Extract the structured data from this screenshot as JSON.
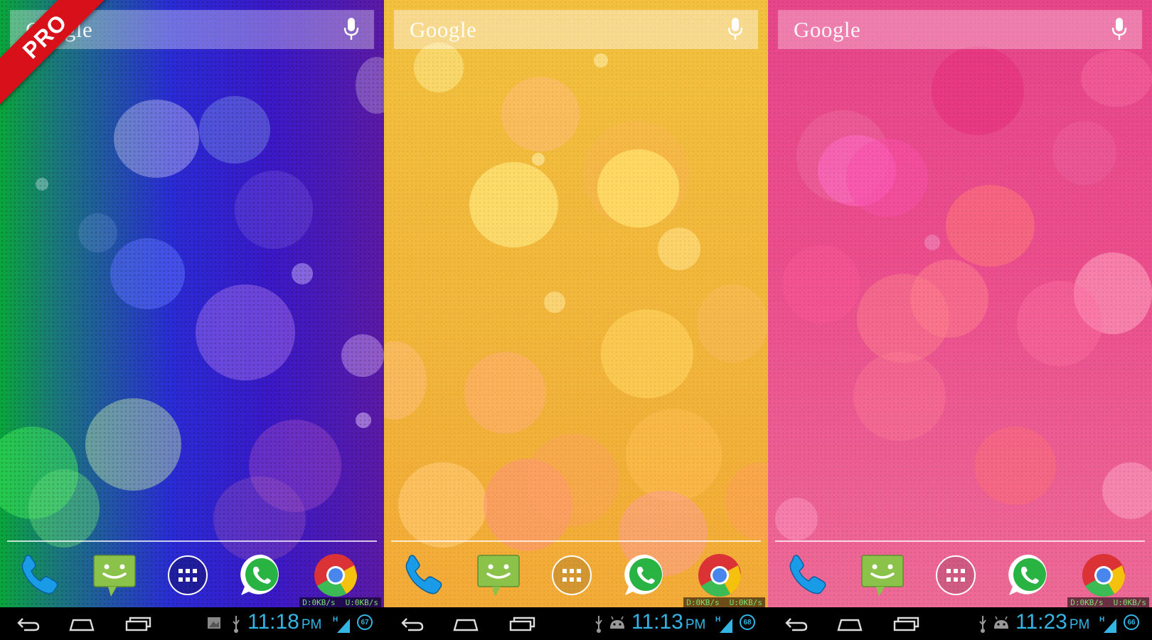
{
  "screens": [
    {
      "theme": "blue",
      "pro_badge": "PRO",
      "search_text": "Google",
      "netspeed_down": "D:0KB/s",
      "netspeed_up": "U:0KB/s",
      "time": "11:18",
      "ampm": "PM",
      "battery": "67"
    },
    {
      "theme": "yellow",
      "search_text": "Google",
      "netspeed_down": "D:0KB/s",
      "netspeed_up": "U:0KB/s",
      "time": "11:13",
      "ampm": "PM",
      "battery": "68"
    },
    {
      "theme": "pink",
      "search_text": "Google",
      "netspeed_down": "D:0KB/s",
      "netspeed_up": "U:0KB/s",
      "time": "11:23",
      "ampm": "PM",
      "battery": "66"
    }
  ],
  "dock_apps": [
    "phone-icon",
    "messaging-icon",
    "app-drawer-icon",
    "whatsapp-icon",
    "chrome-icon"
  ],
  "nav_buttons": [
    "back-icon",
    "home-icon",
    "recent-apps-icon"
  ],
  "colors": {
    "clock": "#33b5e5",
    "pro_ribbon": "#d8101a",
    "netspeed": "#7be36d"
  }
}
